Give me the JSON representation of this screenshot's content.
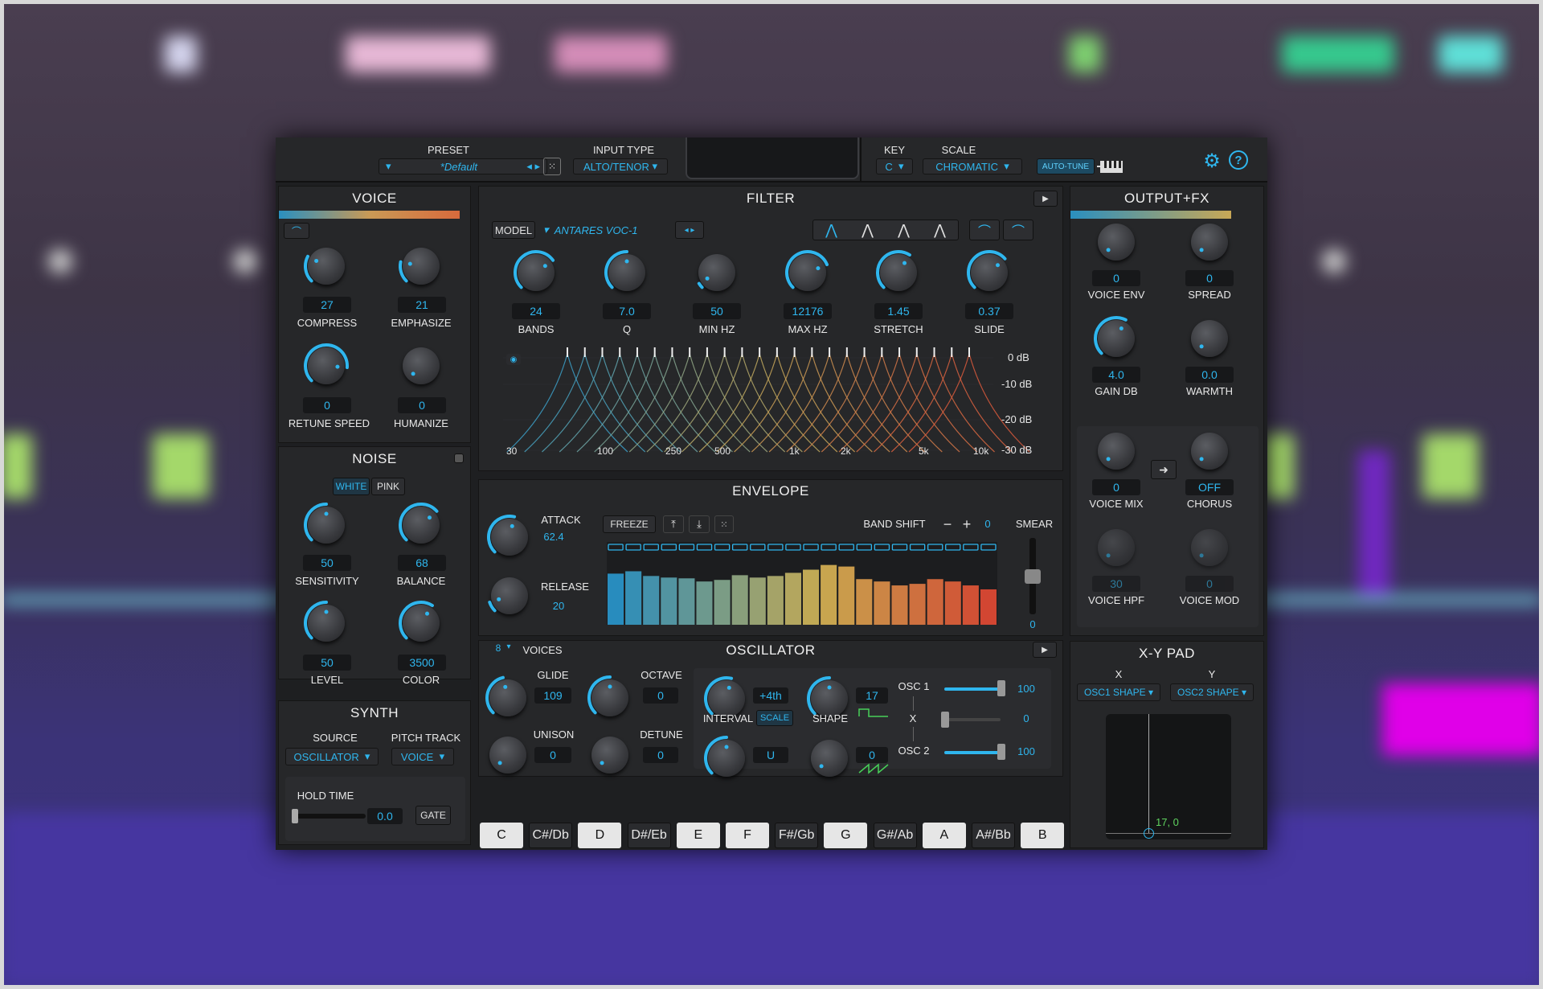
{
  "header": {
    "preset_label": "PRESET",
    "preset_value": "*Default",
    "input_type_label": "INPUT TYPE",
    "input_type_value": "ALTO/TENOR",
    "key_label": "KEY",
    "key_value": "C",
    "scale_label": "SCALE",
    "scale_value": "CHROMATIC",
    "autotune_label": "AUTO-TUNE"
  },
  "voice": {
    "title": "VOICE",
    "knobs": [
      {
        "value": "27",
        "label": "COMPRESS",
        "level": 0.27
      },
      {
        "value": "21",
        "label": "EMPHASIZE",
        "level": 0.21
      },
      {
        "value": "0",
        "label": "RETUNE SPEED",
        "level": 0.85
      },
      {
        "value": "0",
        "label": "HUMANIZE",
        "level": 0.0
      }
    ]
  },
  "noise": {
    "title": "NOISE",
    "white_label": "WHITE",
    "pink_label": "PINK",
    "knobs": [
      {
        "value": "50",
        "label": "SENSITIVITY",
        "level": 0.5
      },
      {
        "value": "68",
        "label": "BALANCE",
        "level": 0.68
      },
      {
        "value": "50",
        "label": "LEVEL",
        "level": 0.5
      },
      {
        "value": "3500",
        "label": "COLOR",
        "level": 0.62
      }
    ]
  },
  "synth": {
    "title": "SYNTH",
    "source_label": "SOURCE",
    "source_value": "OSCILLATOR",
    "pitch_label": "PITCH TRACK",
    "pitch_value": "VOICE",
    "hold_label": "HOLD TIME",
    "hold_value": "0.0",
    "gate_label": "GATE"
  },
  "filter": {
    "title": "FILTER",
    "model_label": "MODEL",
    "model_value": "ANTARES VOC-1",
    "knobs": [
      {
        "value": "24",
        "label": "BANDS",
        "level": 0.7
      },
      {
        "value": "7.0",
        "label": "Q",
        "level": 0.5
      },
      {
        "value": "50",
        "label": "MIN HZ",
        "level": 0.05
      },
      {
        "value": "12176",
        "label": "MAX HZ",
        "level": 0.75
      },
      {
        "value": "1.45",
        "label": "STRETCH",
        "level": 0.62
      },
      {
        "value": "0.37",
        "label": "SLIDE",
        "level": 0.68
      }
    ],
    "db_labels": [
      "0 dB",
      "-10 dB",
      "-20 dB",
      "-30 dB"
    ],
    "freq_labels": [
      "30",
      "100",
      "250",
      "500",
      "1k",
      "2k",
      "5k",
      "10k"
    ]
  },
  "envelope": {
    "title": "ENVELOPE",
    "attack_label": "ATTACK",
    "attack_value": "62.4",
    "release_label": "RELEASE",
    "release_value": "20",
    "freeze_label": "FREEZE",
    "band_shift_label": "BAND SHIFT",
    "band_shift_value": "0",
    "smear_label": "SMEAR",
    "smear_value": "0",
    "bars": [
      0.65,
      0.68,
      0.62,
      0.6,
      0.59,
      0.55,
      0.57,
      0.63,
      0.6,
      0.62,
      0.66,
      0.7,
      0.76,
      0.74,
      0.58,
      0.55,
      0.5,
      0.52,
      0.58,
      0.55,
      0.5,
      0.45
    ]
  },
  "oscillator": {
    "title": "OSCILLATOR",
    "voices_value": "8",
    "voices_label": "VOICES",
    "glide_label": "GLIDE",
    "glide_value": "109",
    "octave_label": "OCTAVE",
    "octave_value": "0",
    "unison_label": "UNISON",
    "unison_value": "0",
    "detune_label": "DETUNE",
    "detune_value": "0",
    "interval_value": "+4th",
    "interval_label": "INTERVAL",
    "scale_btn": "SCALE",
    "shape_value1": "17",
    "shape_label": "SHAPE",
    "u_value": "U",
    "shape_value2": "0",
    "osc1_label": "OSC 1",
    "osc1_value": "100",
    "x_label": "X",
    "x_value": "0",
    "osc2_label": "OSC 2",
    "osc2_value": "100"
  },
  "keys": [
    "C",
    "C#/Db",
    "D",
    "D#/Eb",
    "E",
    "F",
    "F#/Gb",
    "G",
    "G#/Ab",
    "A",
    "A#/Bb",
    "B"
  ],
  "output": {
    "title": "OUTPUT+FX",
    "knobs": [
      {
        "value": "0",
        "label": "VOICE  ENV",
        "level": 0.0
      },
      {
        "value": "0",
        "label": "SPREAD",
        "level": 0.0
      },
      {
        "value": "4.0",
        "label": "GAIN DB",
        "level": 0.6
      },
      {
        "value": "0.0",
        "label": "WARMTH",
        "level": 0.0
      },
      {
        "value": "0",
        "label": "VOICE MIX",
        "level": 0.0
      },
      {
        "value": "OFF",
        "label": "CHORUS",
        "level": 0.0
      },
      {
        "value": "30",
        "label": "VOICE HPF",
        "level": 0.0
      },
      {
        "value": "0",
        "label": "VOICE MOD",
        "level": 0.0
      }
    ]
  },
  "xypad": {
    "title": "X-Y PAD",
    "x_label": "X",
    "y_label": "Y",
    "x_value": "OSC1 SHAPE",
    "y_value": "OSC2 SHAPE",
    "readout": "17, 0"
  },
  "colors": {
    "accent": "#2fb6ee",
    "panel": "#262729"
  }
}
